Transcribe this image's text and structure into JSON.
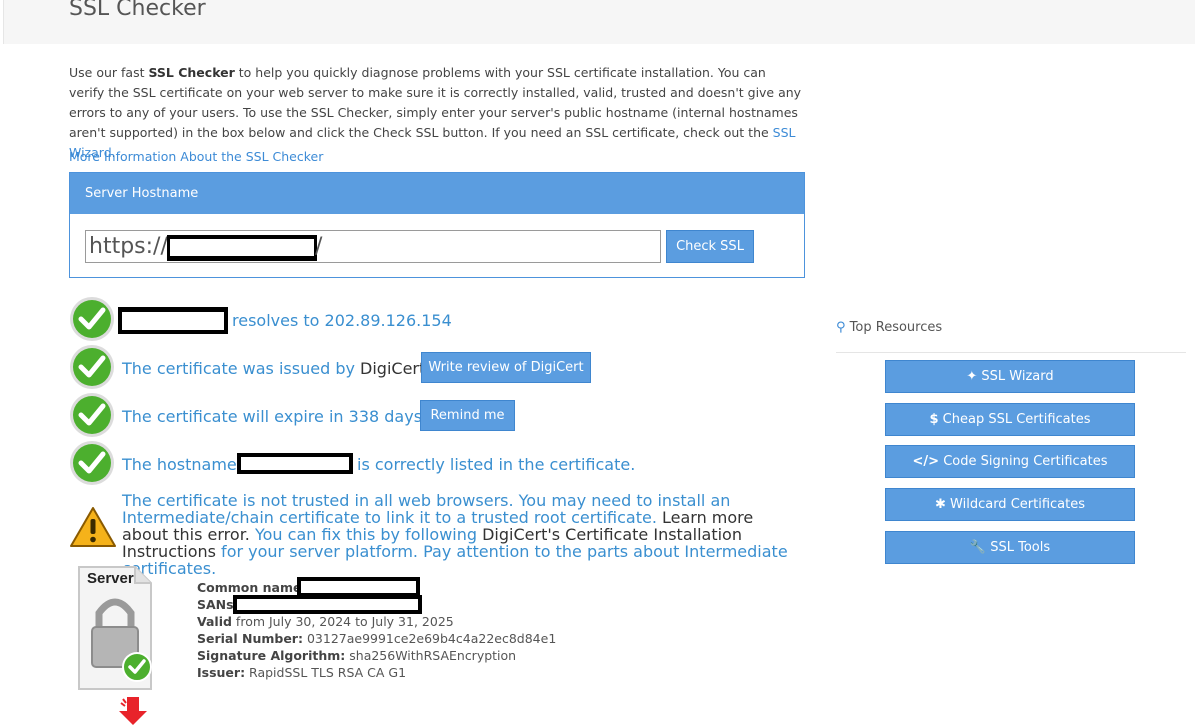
{
  "header": {
    "title": "SSL Checker"
  },
  "intro": {
    "part1": "Use our fast ",
    "bold": "SSL Checker",
    "part2": " to help you quickly diagnose problems with your SSL certificate installation. You can verify the SSL certificate on your web server to make sure it is correctly installed, valid, trusted and doesn't give any errors to any of your users. To use the SSL Checker, simply enter your server's public hostname (internal hostnames aren't supported) in the box below and click the Check SSL button. If you need an SSL certificate, check out the ",
    "wizard_link": "SSL Wizard",
    "part3": "."
  },
  "more_info_link": "More Information About the SSL Checker",
  "form": {
    "panel_title": "Server Hostname",
    "prefix": "https://",
    "suffix": "/",
    "check_button": "Check SSL"
  },
  "results": {
    "resolves": "resolves to 202.89.126.154",
    "issued_prefix": "The certificate was issued by ",
    "issuer_name": "DigiCert",
    "issued_suffix": ".",
    "review_button": "Write review of DigiCert",
    "expire": "The certificate will expire in 338 days.",
    "remind_button": "Remind me",
    "hostname_prefix": "The hostname",
    "hostname_suffix": "is correctly listed in the certificate.",
    "warning": {
      "t1": "The certificate is not trusted in all web browsers. You may need to install an Intermediate/chain certificate to link it to a trusted root certificate. ",
      "t2": "Learn more about this error.",
      "t3": " You can fix this by following ",
      "t4": "DigiCert's Certificate Installation Instructions",
      "t5": " for your server platform. Pay attention to the parts about Intermediate certificates."
    }
  },
  "cert": {
    "icon_label": "Server",
    "common_name_label": "Common name:",
    "sans_label": "SANs:",
    "valid_label": "Valid",
    "valid_value": " from July 30, 2024 to July 31, 2025",
    "serial_label": "Serial Number:",
    "serial_value": " 03127ae9991ce2e69b4c4a22ec8d84e1",
    "sig_label": "Signature Algorithm:",
    "sig_value": " sha256WithRSAEncryption",
    "issuer_label": "Issuer:",
    "issuer_value": " RapidSSL TLS RSA CA G1"
  },
  "sidebar": {
    "title": "Top Resources",
    "items": [
      {
        "label": "SSL Wizard",
        "icon": "magic-wand-icon"
      },
      {
        "label": "Cheap SSL Certificates",
        "icon": "dollar-icon"
      },
      {
        "label": "Code Signing Certificates",
        "icon": "code-icon"
      },
      {
        "label": "Wildcard Certificates",
        "icon": "asterisk-icon"
      },
      {
        "label": "SSL Tools",
        "icon": "wrench-icon"
      }
    ]
  },
  "colors": {
    "accent": "#5b9de0",
    "link": "#3a8fd0",
    "success": "#4caf2e",
    "warning": "#f5b21a"
  }
}
